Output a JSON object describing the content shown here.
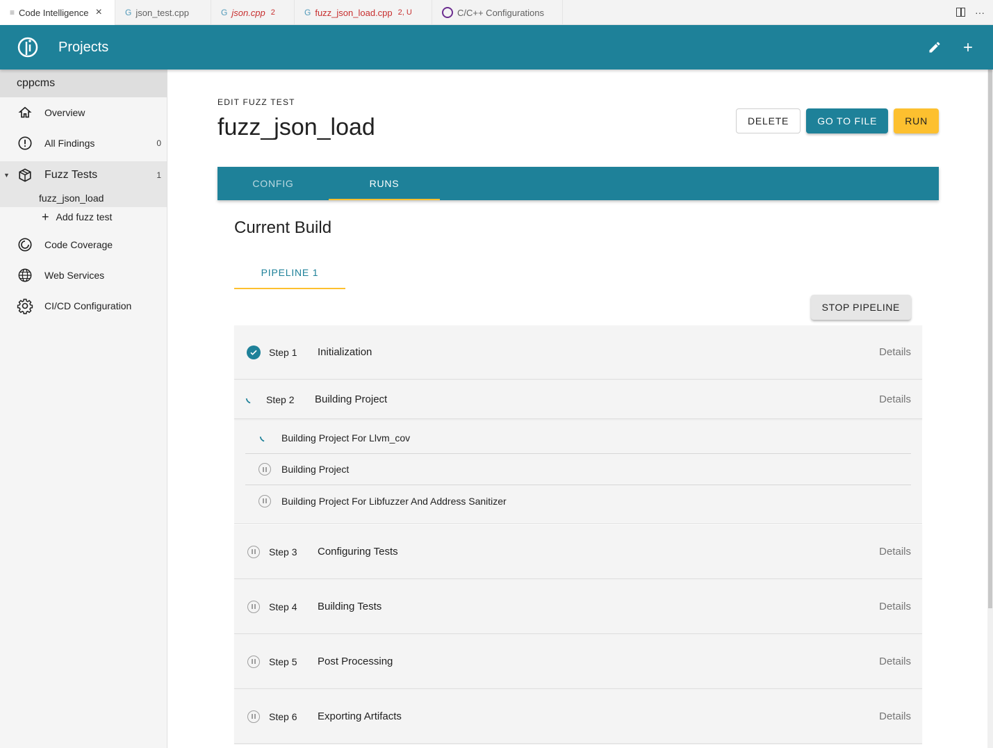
{
  "editor_tabs": [
    {
      "label": "Code Intelligence",
      "active": true
    },
    {
      "label": "json_test.cpp"
    },
    {
      "label": "json.cpp",
      "badge": "2"
    },
    {
      "label": "fuzz_json_load.cpp",
      "badge": "2, U"
    },
    {
      "label": "C/C++ Configurations"
    }
  ],
  "appbar": {
    "title": "Projects"
  },
  "sidebar": {
    "project": "cppcms",
    "overview": "Overview",
    "all_findings": "All Findings",
    "all_findings_count": "0",
    "fuzz_tests": "Fuzz Tests",
    "fuzz_tests_count": "1",
    "fuzz_test_item": "fuzz_json_load",
    "add_fuzz_test": "Add fuzz test",
    "code_coverage": "Code Coverage",
    "web_services": "Web Services",
    "cicd": "CI/CD Configuration"
  },
  "main": {
    "overline": "EDIT FUZZ TEST",
    "title": "fuzz_json_load",
    "delete_label": "DELETE",
    "go_to_file_label": "GO TO FILE",
    "run_label": "RUN",
    "tabs": [
      "CONFIG",
      "RUNS"
    ],
    "section_title": "Current Build",
    "pipeline_tab": "PIPELINE 1",
    "stop_label": "STOP PIPELINE",
    "details_label": "Details",
    "steps": [
      {
        "label": "Step 1",
        "title": "Initialization",
        "status": "done"
      },
      {
        "label": "Step 2",
        "title": "Building Project",
        "status": "running"
      },
      {
        "label": "Step 3",
        "title": "Configuring Tests",
        "status": "pending"
      },
      {
        "label": "Step 4",
        "title": "Building Tests",
        "status": "pending"
      },
      {
        "label": "Step 5",
        "title": "Post Processing",
        "status": "pending"
      },
      {
        "label": "Step 6",
        "title": "Exporting Artifacts",
        "status": "pending"
      }
    ],
    "substeps": [
      {
        "title": "Building Project For Llvm_cov",
        "status": "running"
      },
      {
        "title": "Building Project",
        "status": "pending"
      },
      {
        "title": "Building Project For Libfuzzer And Address Sanitizer",
        "status": "pending"
      }
    ]
  },
  "colors": {
    "primary": "#1e8199",
    "accent": "#fdc02f"
  }
}
